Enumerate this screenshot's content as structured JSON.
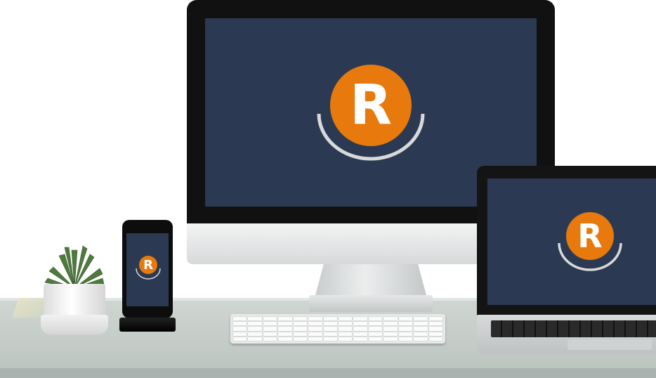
{
  "scene": {
    "description_tag": "device-mockup",
    "colors": {
      "screen_background": "#2b3a52",
      "logo_accent": "#e8790c",
      "logo_letter": "#ffffff",
      "arc": "#d9d9d9"
    }
  },
  "logo": {
    "letter": "R",
    "icon": "r-logo-icon"
  }
}
